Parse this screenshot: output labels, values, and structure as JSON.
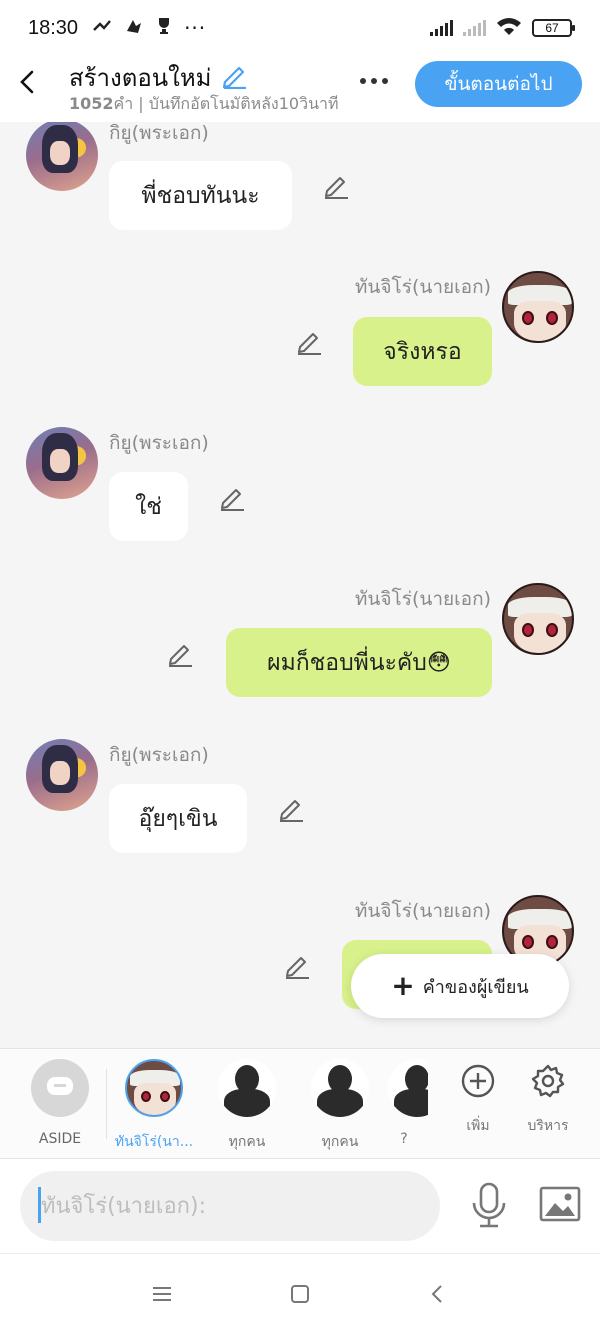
{
  "status_bar": {
    "time": "18:30",
    "notification_icons": [
      "twitter-icon",
      "notification-icon",
      "trophy-icon",
      "more-notifications-icon"
    ],
    "more_notifications": "···",
    "battery": "67"
  },
  "header": {
    "title": "สร้างตอนใหม่",
    "word_count": "1052",
    "subtitle_rest": "คำ | บันทึกอัตโนมัติหลัง10วินาที",
    "next_button": "ขั้นตอนต่อไป"
  },
  "messages": [
    {
      "side": "left",
      "character": "กิยู(พระเอก)",
      "text": "พี่ชอบทันนะ"
    },
    {
      "side": "right",
      "character": "ทันจิโร่(นายเอก)",
      "text": "จริงหรอ"
    },
    {
      "side": "left",
      "character": "กิยู(พระเอก)",
      "text": "ใช่"
    },
    {
      "side": "right",
      "character": "ทันจิโร่(นายเอก)",
      "text": "ผมก็ชอบพี่นะคับ😳"
    },
    {
      "side": "left",
      "character": "กิยู(พระเอก)",
      "text": "อุ๊ยๆเขิน"
    },
    {
      "side": "right",
      "character": "ทันจิโร่(นายเอก)",
      "text": ""
    }
  ],
  "fab": {
    "label": "คำของผู้เขียน"
  },
  "character_bar": {
    "items": [
      {
        "label": "ASIDE",
        "active": false
      },
      {
        "label": "ทันจิโร่(นา...",
        "active": true
      },
      {
        "label": "ทุกคน",
        "active": false
      },
      {
        "label": "ทุกคน",
        "active": false
      },
      {
        "label": "? ",
        "active": false
      }
    ],
    "add_label": "เพิ่ม",
    "manage_label": "บริหาร"
  },
  "composer": {
    "placeholder": "ทันจิโร่(นายเอก):"
  },
  "colors": {
    "accent": "#4aa3f2",
    "bubble_right": "#d8f18b",
    "bubble_left": "#ffffff",
    "background": "#f5f5f5"
  }
}
